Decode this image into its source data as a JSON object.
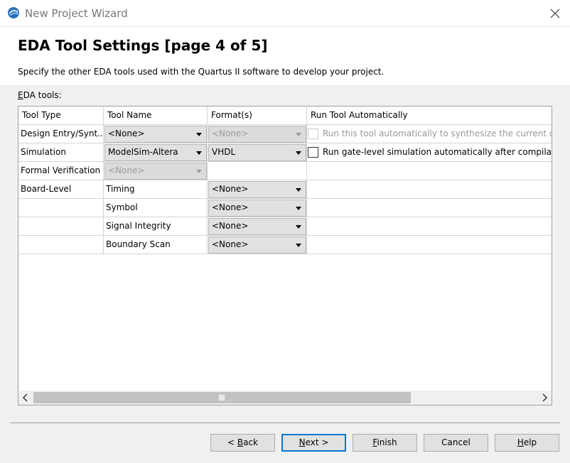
{
  "window": {
    "title": "New Project Wizard"
  },
  "header": {
    "title": "EDA Tool Settings [page 4 of 5]",
    "description": "Specify the other EDA tools used with the Quartus II software to develop your project."
  },
  "eda_label": {
    "accel": "E",
    "rest": "DA tools:"
  },
  "table": {
    "columns": [
      "Tool Type",
      "Tool Name",
      "Format(s)",
      "Run Tool Automatically"
    ],
    "rows": [
      {
        "tool_type": "Design Entry/Synt...",
        "tool_name": "<None>",
        "tool_name_disabled": false,
        "format": "<None>",
        "format_disabled": true,
        "run_label": "Run this tool automatically to synthesize the current design",
        "run_disabled": true,
        "run_checked": false
      },
      {
        "tool_type": "Simulation",
        "tool_name": "ModelSim-Altera",
        "tool_name_disabled": false,
        "format": "VHDL",
        "format_disabled": false,
        "run_label": "Run gate-level simulation automatically after compilation",
        "run_disabled": false,
        "run_checked": false
      },
      {
        "tool_type": "Formal Verification",
        "tool_name": "<None>",
        "tool_name_disabled": true
      },
      {
        "tool_type": "Board-Level",
        "tool_name": "Timing",
        "format": "<None>"
      },
      {
        "tool_type": "",
        "tool_name": "Symbol",
        "format": "<None>"
      },
      {
        "tool_type": "",
        "tool_name": "Signal Integrity",
        "format": "<None>"
      },
      {
        "tool_type": "",
        "tool_name": "Boundary Scan",
        "format": "<None>"
      }
    ]
  },
  "buttons": {
    "back": {
      "pre": "< ",
      "accel": "B",
      "post": "ack"
    },
    "next": {
      "pre": "",
      "accel": "N",
      "post": "ext >"
    },
    "finish": {
      "pre": "",
      "accel": "F",
      "post": "inish"
    },
    "cancel": {
      "pre": "",
      "accel": "",
      "post": "Cancel"
    },
    "help": {
      "pre": "",
      "accel": "H",
      "post": "elp"
    }
  },
  "colors": {
    "accent": "#0078d7",
    "disabled_text": "#999999",
    "grid": "#d4d4d4"
  },
  "icons": [
    "quartus-app-icon",
    "close-icon",
    "dropdown-arrow-icon",
    "scroll-left-icon",
    "scroll-right-icon"
  ]
}
